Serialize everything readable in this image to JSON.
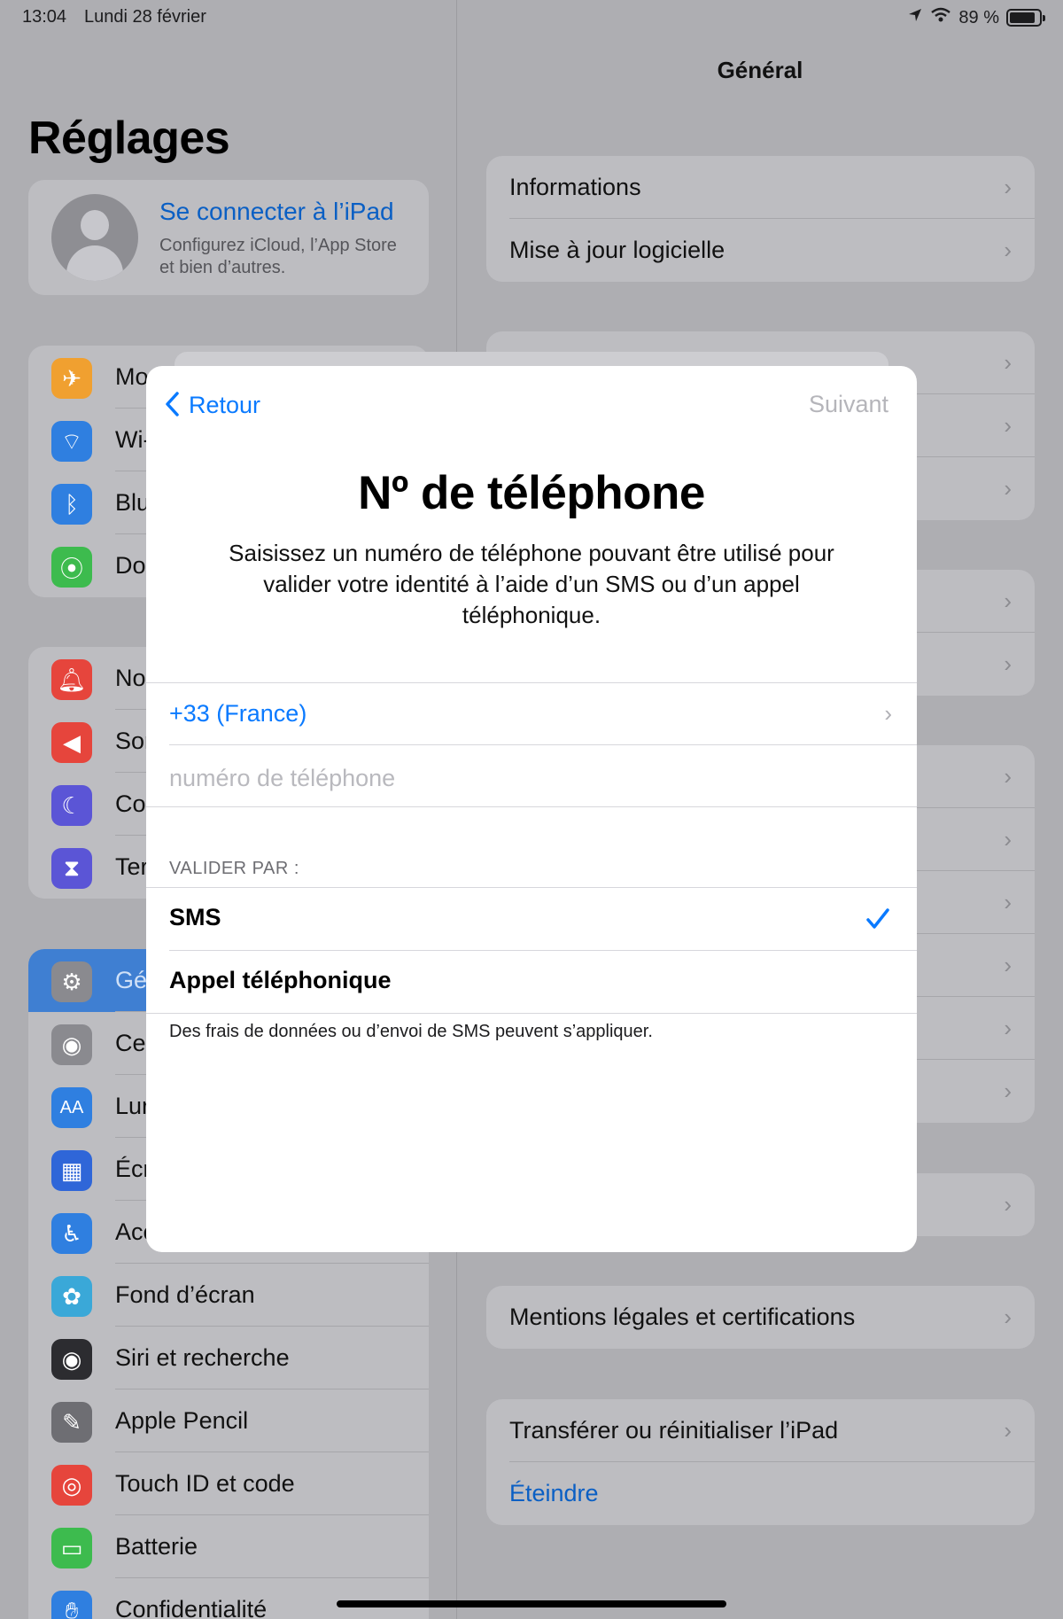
{
  "status_bar": {
    "time": "13:04",
    "date": "Lundi 28 février",
    "battery": "89 %",
    "battery_level": 0.89
  },
  "sidebar": {
    "title": "Réglages",
    "profile": {
      "title": "Se connecter à l’iPad",
      "subtitle": "Configurez iCloud, l’App Store et bien d’autres."
    },
    "groups": [
      [
        {
          "label": "Mo",
          "icon": "airplane-icon",
          "color": "#f0a030"
        },
        {
          "label": "Wi-",
          "icon": "wifi-icon",
          "color": "#2f7fe0"
        },
        {
          "label": "Blu",
          "icon": "bluetooth-icon",
          "color": "#2f7fe0"
        },
        {
          "label": "Do",
          "icon": "antenna-icon",
          "color": "#3dbb4e"
        }
      ],
      [
        {
          "label": "No",
          "icon": "bell-icon",
          "color": "#e6453c"
        },
        {
          "label": "Sor",
          "icon": "speaker-icon",
          "color": "#e6453c"
        },
        {
          "label": "Co",
          "icon": "moon-icon",
          "color": "#5b55d6"
        },
        {
          "label": "Ter",
          "icon": "hourglass-icon",
          "color": "#5b55d6"
        }
      ],
      [
        {
          "label": "Gé",
          "icon": "gear-icon",
          "color": "#8a8a8f",
          "selected": true
        },
        {
          "label": "Ce",
          "icon": "toggles-icon",
          "color": "#8a8a8f"
        },
        {
          "label": "Lur",
          "icon": "text-size-icon",
          "color": "#2f7fe0"
        },
        {
          "label": "Écr",
          "icon": "grid-icon",
          "color": "#2f66d8"
        },
        {
          "label": "Acc",
          "icon": "accessibility-icon",
          "color": "#2f7fe0"
        },
        {
          "label": "Fond d’écran",
          "icon": "flower-icon",
          "color": "#3aa8d8"
        },
        {
          "label": "Siri et recherche",
          "icon": "siri-icon",
          "color": "#2c2c30"
        },
        {
          "label": "Apple Pencil",
          "icon": "pencil-icon",
          "color": "#6e6e73"
        },
        {
          "label": "Touch ID et code",
          "icon": "fingerprint-icon",
          "color": "#e6453c"
        },
        {
          "label": "Batterie",
          "icon": "battery-icon",
          "color": "#3dbb4e"
        },
        {
          "label": "Confidentialité",
          "icon": "hand-icon",
          "color": "#2f7fe0"
        }
      ]
    ]
  },
  "detail": {
    "title": "Général",
    "group1": [
      "Informations",
      "Mise à jour logicielle"
    ],
    "legal": "Mentions légales et certifications",
    "reset": "Transférer ou réinitialiser l’iPad",
    "shutdown": "Éteindre"
  },
  "modal": {
    "back_label": "Retour",
    "next_label": "Suivant",
    "title": "Nº de téléphone",
    "description": "Saisissez un numéro de téléphone pouvant être utilisé pour valider votre identité à l’aide d’un SMS ou d’un appel téléphonique.",
    "country": "+33 (France)",
    "phone_placeholder": "numéro de téléphone",
    "phone_value": "",
    "section_header": "VALIDER PAR :",
    "options": [
      {
        "label": "SMS",
        "selected": true
      },
      {
        "label": "Appel téléphonique",
        "selected": false
      }
    ],
    "footnote": "Des frais de données ou d’envoi de SMS peuvent s’appliquer."
  }
}
